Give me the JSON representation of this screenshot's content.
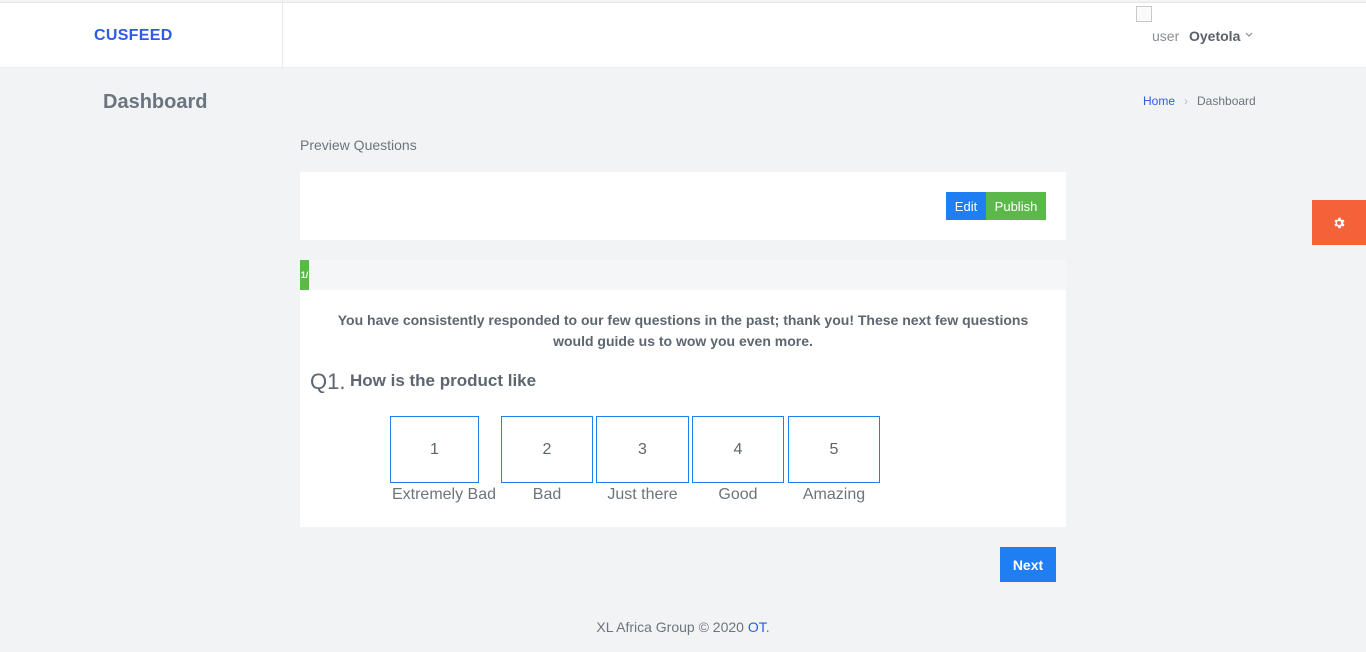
{
  "header": {
    "brand": "CUSFEED",
    "user_alt": "user",
    "user_name": "Oyetola"
  },
  "page": {
    "title": "Dashboard",
    "breadcrumb": {
      "home": "Home",
      "separator": "›",
      "current": "Dashboard"
    }
  },
  "preview": {
    "label": "Preview Questions",
    "edit_label": "Edit",
    "publish_label": "Publish"
  },
  "survey": {
    "progress_text": "1/",
    "progress_fraction": 0.012,
    "intro": "You have consistently responded to our few questions in the past; thank you! These next few questions would guide us to wow you even more.",
    "question_number": "Q1.",
    "question_text": "How is the product like",
    "options": [
      {
        "value": "1",
        "label": "Extremely Bad"
      },
      {
        "value": "2",
        "label": "Bad"
      },
      {
        "value": "3",
        "label": "Just there"
      },
      {
        "value": "4",
        "label": "Good"
      },
      {
        "value": "5",
        "label": "Amazing"
      }
    ],
    "next_label": "Next"
  },
  "footer": {
    "text": "XL Africa Group © 2020 ",
    "link": "OT",
    "suffix": "."
  },
  "colors": {
    "brand": "#2d5be3",
    "primary": "#1e7ef2",
    "success": "#5cb84a",
    "settings": "#f4623a"
  },
  "icons": {
    "settings": "gear-icon",
    "user_menu": "chevron-down-icon"
  }
}
